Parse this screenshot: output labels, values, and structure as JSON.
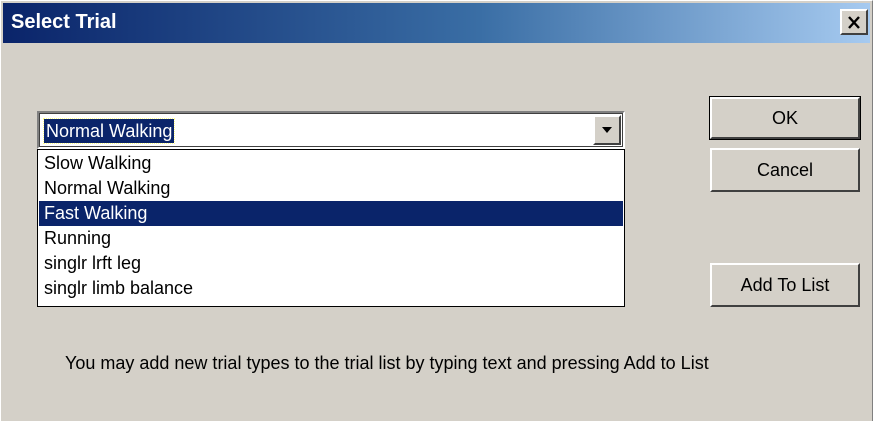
{
  "window": {
    "title": "Select Trial",
    "close_icon": "close-icon"
  },
  "combo": {
    "selected_value": "Normal Walking",
    "arrow_icon": "chevron-down-icon"
  },
  "dropdown": {
    "items": [
      {
        "label": "Slow Walking",
        "selected": false
      },
      {
        "label": "Normal Walking",
        "selected": false
      },
      {
        "label": "Fast Walking",
        "selected": true
      },
      {
        "label": "Running",
        "selected": false
      },
      {
        "label": "singlr lrft leg",
        "selected": false
      },
      {
        "label": "singlr limb balance",
        "selected": false
      }
    ]
  },
  "buttons": {
    "ok_label": "OK",
    "cancel_label": "Cancel",
    "add_label": "Add To List"
  },
  "hint_text": "You may add new trial types to the trial list by typing text and pressing Add to List",
  "colors": {
    "titlebar_start": "#0a246a",
    "titlebar_end": "#a6caf0",
    "face": "#d4d0c8",
    "highlight": "#0a246a"
  }
}
